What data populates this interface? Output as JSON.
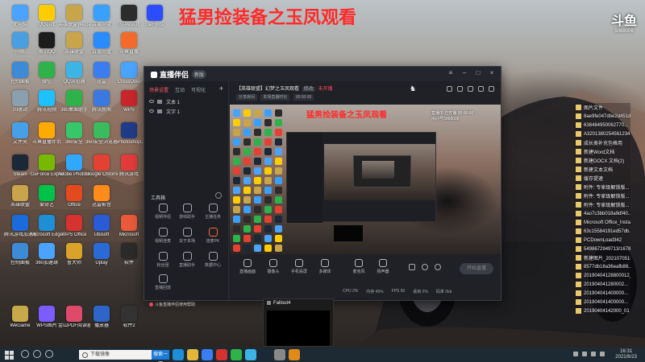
{
  "banner": "猛男捡装备之玉凤观看",
  "desktop_icons": [
    {
      "label": "此电脑",
      "color": "#4aa3ff"
    },
    {
      "label": "QQ游戏",
      "color": "#ffcc00"
    },
    {
      "label": "英雄联盟WeGame版",
      "color": "#c8a54a"
    },
    {
      "label": "百度网盘",
      "color": "#3aa0ff"
    },
    {
      "label": "GTAV游戏",
      "color": "#2c2c2c"
    },
    {
      "label": "GeForce",
      "color": "#2c4cff"
    },
    {
      "label": "网络",
      "color": "#4a9fe0"
    },
    {
      "label": "腾讯QQ",
      "color": "#1d1d1d"
    },
    {
      "label": "英雄联盟",
      "color": "#c8a54a"
    },
    {
      "label": "百度网盘",
      "color": "#2a8bff"
    },
    {
      "label": "斗鱼直播",
      "color": "#f36b2a"
    },
    {
      "label": "控制面板",
      "color": "#3d8ad6"
    },
    {
      "label": "微信",
      "color": "#2fb24a"
    },
    {
      "label": "QQ浏览器",
      "color": "#3cb4e6"
    },
    {
      "label": "迅雷",
      "color": "#3a7df0"
    },
    {
      "label": "CrossOver",
      "color": "#4aa3ff"
    },
    {
      "label": "回收站",
      "color": "#8aa0b0"
    },
    {
      "label": "腾讯视频",
      "color": "#1ec0ff"
    },
    {
      "label": "360桌面助手",
      "color": "#2db34a"
    },
    {
      "label": "腾讯新闻",
      "color": "#3a79e0"
    },
    {
      "label": "WPS",
      "color": "#c8262d"
    },
    {
      "label": "文件夹",
      "color": "#46a0e8"
    },
    {
      "label": "斗鱼直播伴侣",
      "color": "#ffaa00"
    },
    {
      "label": "360安全",
      "color": "#37c76a"
    },
    {
      "label": "360安全浏览器",
      "color": "#3bba5e"
    },
    {
      "label": "Photoshop",
      "color": "#1f3c88"
    },
    {
      "label": "CAD快速看图",
      "color": "#e02020"
    },
    {
      "label": "Steam",
      "color": "#1b2838"
    },
    {
      "label": "GeForce Experience",
      "color": "#76b900"
    },
    {
      "label": "Adobe Photoshop",
      "color": "#31a8ff"
    },
    {
      "label": "Google Chrome",
      "color": "#e34133"
    },
    {
      "label": "腾讯游戏",
      "color": "#e33b3b"
    },
    {
      "label": "英雄联盟",
      "color": "#c8a54a"
    },
    {
      "label": "爱奇艺",
      "color": "#00c24a"
    },
    {
      "label": "Office",
      "color": "#e34b1f"
    },
    {
      "label": "迅雷影音",
      "color": "#ff8c1a"
    },
    {
      "label": "腾讯游戏加速器",
      "color": "#1a6bdc"
    },
    {
      "label": "Microsoft Edge",
      "color": "#1e8fd6"
    },
    {
      "label": "WPS Office",
      "color": "#d6322f"
    },
    {
      "label": "Ubisoft",
      "color": "#2a5bd7"
    },
    {
      "label": "Microsoft",
      "color": "#e85a3a"
    },
    {
      "label": "控制面板",
      "color": "#3d8ad6"
    },
    {
      "label": "360加速球",
      "color": "#4aa3ff"
    },
    {
      "label": "鲁大师",
      "color": "#d9a22a"
    },
    {
      "label": "Uplay",
      "color": "#2a6ad7"
    },
    {
      "label": "软件",
      "color": "#2b2b2b"
    },
    {
      "label": "WeGame",
      "color": "#c9a84b"
    },
    {
      "label": "WPS图片",
      "color": "#7a5cff"
    },
    {
      "label": "金山PDF阅读器",
      "color": "#e04a6a"
    },
    {
      "label": "播放器",
      "color": "#2d66c8"
    },
    {
      "label": "软件2",
      "color": "#333"
    }
  ],
  "right_logo": {
    "main": "斗鱼",
    "sub": "5068006"
  },
  "file_list": [
    "图片文件",
    "8ae9fe047dbe2d451d...",
    "638484950062770...",
    "A3201380254561234",
    "成长类补充包格用",
    "新建Word文档",
    "新建DOCX 文档(2)",
    "新建文本文档",
    "缓存提速",
    "附件: 专家级解锁版...",
    "附件: 专家级解锁版...",
    "附件: 专家级解锁版...",
    "4ao7c3bb018a9df40...",
    "Microsoft Office_Install...",
    "63c15584191ed57db...",
    "PCDownLoad342",
    "5498672949713/1678",
    "新建图片_20210705183...",
    "8577db18a36eafb88...",
    "20190404128800012_01",
    "201904041280002...",
    "201904041400000...",
    "201904041400000...",
    "20190404142000_01"
  ],
  "app": {
    "name": "直播伴侣",
    "version_badge": "新版",
    "left_tabs": [
      "场景设置",
      "互动",
      "可视化",
      "+"
    ],
    "scenes": [
      "文本 1",
      "文字 1"
    ],
    "tools_heading": "工具箱",
    "tools": [
      "视频伴侣",
      "游戏助手",
      "主播任务",
      "视频连麦",
      "关于本场",
      "连麦PK",
      "粉丝团",
      "直播助手",
      "数据中心",
      "直播回放"
    ],
    "bottom_note": "斗鱼直播伴侣使用帮助",
    "room_title": "【英雄联盟】幻梦之玉凤观看",
    "room_tag": "修改",
    "room_red": "未开播",
    "room_sub": [
      "分享房间",
      "本场直播时长",
      "00:00:00"
    ],
    "preview_banner": "猛男捡装备之玉凤观看",
    "preview_info": [
      "直播中 已开播 00:00:00",
      "房间号5068006"
    ],
    "bottom_tools": [
      "直播画面",
      "摄像头",
      "手机投屏",
      "多媒体",
      "麦克风",
      "扬声器"
    ],
    "golive": "开始直播",
    "status": [
      "CPU 2%",
      "内存 45%",
      "FPS 60",
      "丢帧 0%",
      "码率 0kb"
    ]
  },
  "fallout": {
    "title": "Fallout4"
  },
  "taskbar": {
    "search_placeholder": "下载镜像",
    "search_button": "搜索一下",
    "clock_time": "16:31",
    "clock_date": "2021/6/23"
  }
}
